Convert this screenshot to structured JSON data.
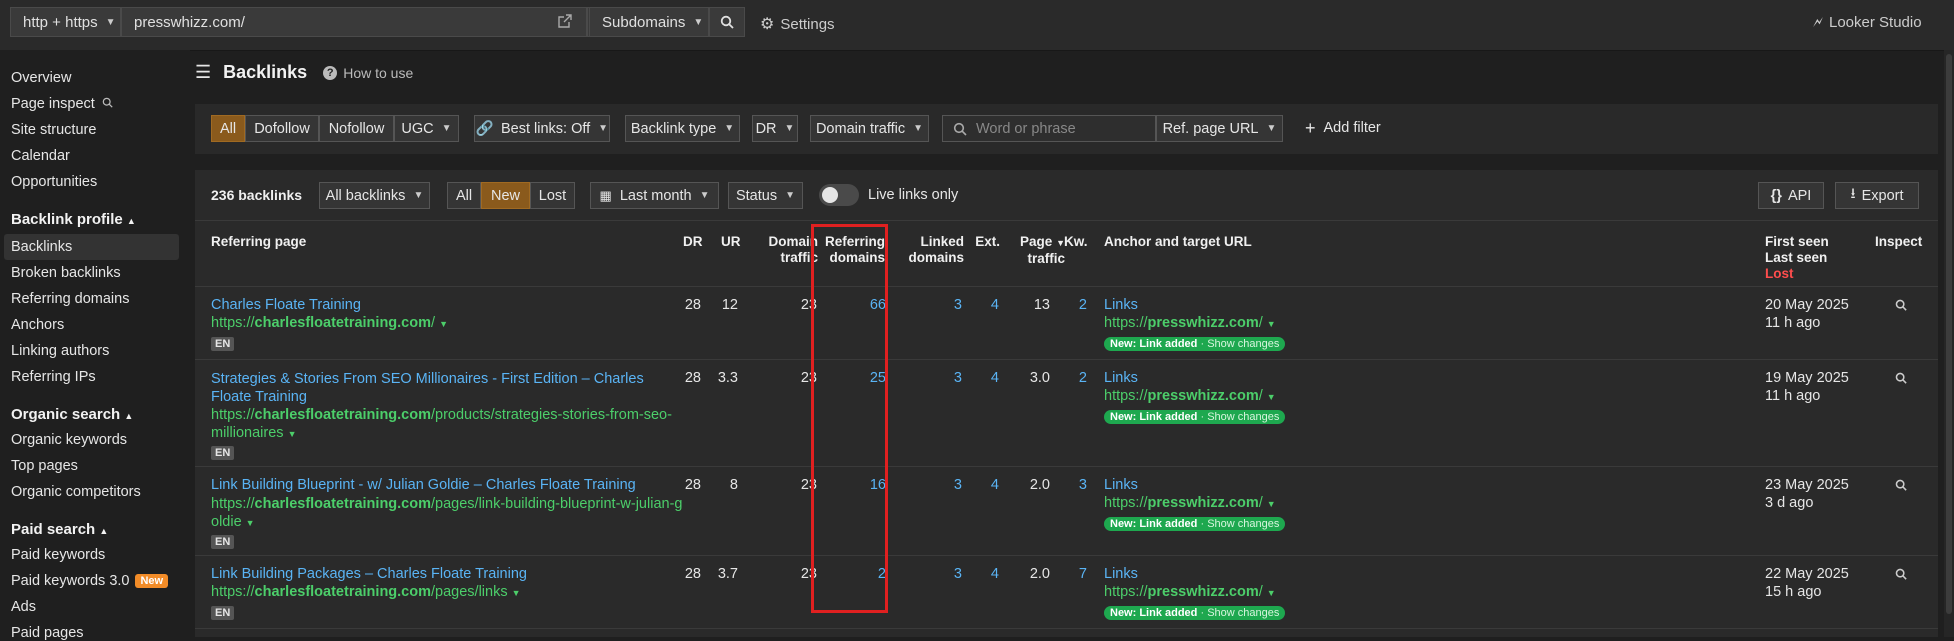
{
  "topbar": {
    "protocol": "http + https",
    "url": "presswhizz.com/",
    "mode": "Subdomains",
    "settings": "Settings",
    "looker": "Looker Studio"
  },
  "sidebar": {
    "items_top": [
      "Overview",
      "Page inspect",
      "Site structure",
      "Calendar",
      "Opportunities"
    ],
    "backlink_profile": {
      "title": "Backlink profile",
      "items": [
        "Backlinks",
        "Broken backlinks",
        "Referring domains",
        "Anchors",
        "Linking authors",
        "Referring IPs"
      ]
    },
    "organic_search": {
      "title": "Organic search",
      "items": [
        "Organic keywords",
        "Top pages",
        "Organic competitors"
      ]
    },
    "paid_search": {
      "title": "Paid search",
      "items": [
        "Paid keywords",
        "Paid keywords 3.0",
        "Ads",
        "Paid pages"
      ],
      "new_badge": "New"
    }
  },
  "main": {
    "title": "Backlinks",
    "how_to_use": "How to use"
  },
  "filters": {
    "type_all": "All",
    "dofollow": "Dofollow",
    "nofollow": "Nofollow",
    "ugc": "UGC",
    "best_links": "Best links: Off",
    "backlink_type": "Backlink type",
    "dr": "DR",
    "domain_traffic": "Domain traffic",
    "search_placeholder": "Word or phrase",
    "ref_page_url": "Ref. page URL",
    "add_filter": "Add filter"
  },
  "toolbar": {
    "count": "236 backlinks",
    "all_backlinks": "All backlinks",
    "all": "All",
    "new": "New",
    "lost": "Lost",
    "last_month": "Last month",
    "status": "Status",
    "live_links_only": "Live links only",
    "api": "API",
    "export": "Export"
  },
  "columns": {
    "referring_page": "Referring page",
    "dr": "DR",
    "ur": "UR",
    "domain_traffic_1": "Domain",
    "domain_traffic_2": "traffic",
    "referring_domains_1": "Referring",
    "referring_domains_2": "domains",
    "linked_domains_1": "Linked",
    "linked_domains_2": "domains",
    "ext": "Ext.",
    "page_traffic_1": "Page",
    "page_traffic_2": "traffic",
    "kw": "Kw.",
    "anchor": "Anchor and target URL",
    "first_seen": "First seen",
    "last_seen": "Last seen",
    "lost": "Lost",
    "inspect": "Inspect"
  },
  "rows": [
    {
      "title_1": "Charles Floate Training",
      "title_2": "",
      "url_prefix": "https://",
      "url_domain": "charlesfloatetraining.com",
      "url_path_1": "/",
      "url_path_2": "",
      "lang": "EN",
      "dr": "28",
      "ur": "12",
      "domain_traffic": "23",
      "referring_domains": "66",
      "linked_domains": "3",
      "ext": "4",
      "page_traffic": "13",
      "kw": "2",
      "anchor": "Links",
      "target_prefix": "https://",
      "target_domain": "presswhizz.com",
      "target_path": "/",
      "tag_new": "New: Link added",
      "tag_changes": "· Show changes",
      "first_seen": "20 May 2025",
      "last_seen": "11 h ago"
    },
    {
      "title_1": "Strategies & Stories From SEO Millionaires - First Edition – Charles",
      "title_2": "Floate Training",
      "url_prefix": "https://",
      "url_domain": "charlesfloatetraining.com",
      "url_path_1": "/products/strategies-stories-from-seo-",
      "url_path_2": "millionaires",
      "lang": "EN",
      "dr": "28",
      "ur": "3.3",
      "domain_traffic": "23",
      "referring_domains": "25",
      "linked_domains": "3",
      "ext": "4",
      "page_traffic": "3.0",
      "kw": "2",
      "anchor": "Links",
      "target_prefix": "https://",
      "target_domain": "presswhizz.com",
      "target_path": "/",
      "tag_new": "New: Link added",
      "tag_changes": "· Show changes",
      "first_seen": "19 May 2025",
      "last_seen": "11 h ago"
    },
    {
      "title_1": "Link Building Blueprint - w/ Julian Goldie – Charles Floate Training",
      "title_2": "",
      "url_prefix": "https://",
      "url_domain": "charlesfloatetraining.com",
      "url_path_1": "/pages/link-building-blueprint-w-julian-g",
      "url_path_2": "oldie",
      "lang": "EN",
      "dr": "28",
      "ur": "8",
      "domain_traffic": "23",
      "referring_domains": "16",
      "linked_domains": "3",
      "ext": "4",
      "page_traffic": "2.0",
      "kw": "3",
      "anchor": "Links",
      "target_prefix": "https://",
      "target_domain": "presswhizz.com",
      "target_path": "/",
      "tag_new": "New: Link added",
      "tag_changes": "· Show changes",
      "first_seen": "23 May 2025",
      "last_seen": "3 d ago"
    },
    {
      "title_1": "Link Building Packages – Charles Floate Training",
      "title_2": "",
      "url_prefix": "https://",
      "url_domain": "charlesfloatetraining.com",
      "url_path_1": "/pages/links",
      "url_path_2": "",
      "lang": "EN",
      "dr": "28",
      "ur": "3.7",
      "domain_traffic": "23",
      "referring_domains": "2",
      "linked_domains": "3",
      "ext": "4",
      "page_traffic": "2.0",
      "kw": "7",
      "anchor": "Links",
      "target_prefix": "https://",
      "target_domain": "presswhizz.com",
      "target_path": "/",
      "tag_new": "New: Link added",
      "tag_changes": "· Show changes",
      "first_seen": "22 May 2025",
      "last_seen": "15 h ago"
    }
  ]
}
